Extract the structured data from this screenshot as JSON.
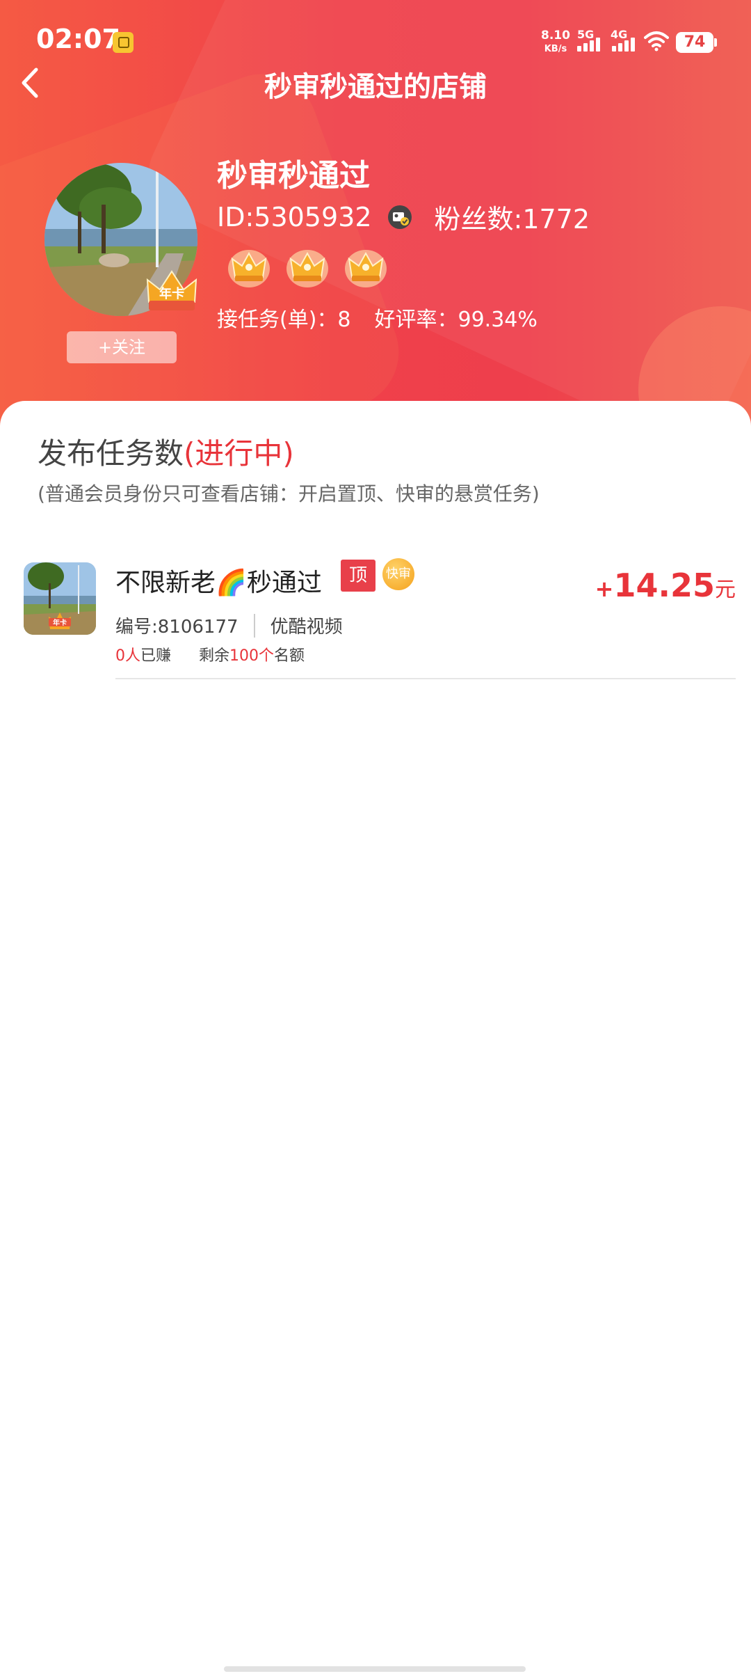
{
  "status_bar": {
    "time": "02:07",
    "net_speed_value": "8.10",
    "net_speed_unit": "KB/s",
    "signal1": "5G",
    "signal2": "4G",
    "battery": "74"
  },
  "nav": {
    "title": "秒审秒通过的店铺"
  },
  "profile": {
    "name": "秒审秒通过",
    "id_text": "ID:5305932",
    "fans_text": "粉丝数:1772",
    "crown_count": 3,
    "badge_text": "年卡",
    "follow_label": "+关注",
    "tasks_received": "接任务(单)：8",
    "rating": "好评率：99.34%"
  },
  "section": {
    "title": "发布任务数",
    "title_highlight": "(进行中)",
    "note": "(普通会员身份只可查看店铺：开启置顶、快审的悬赏任务)"
  },
  "tasks": [
    {
      "title": "不限新老🌈秒通过",
      "tag_top": "顶",
      "tag_fast": "快审",
      "price_plus": "+",
      "price": "14.25",
      "price_unit": "元",
      "number": "编号:8106177",
      "platform": "优酷视频",
      "earned_count": "0人",
      "earned_label": "已赚",
      "remaining_prefix": "剩余",
      "remaining_count": "100个",
      "remaining_suffix": "名额",
      "thumb_badge": "年卡"
    }
  ],
  "colors": {
    "header_red": "#ef424b",
    "accent_red": "#e8343a",
    "tag_orange": "#f4a11c"
  }
}
